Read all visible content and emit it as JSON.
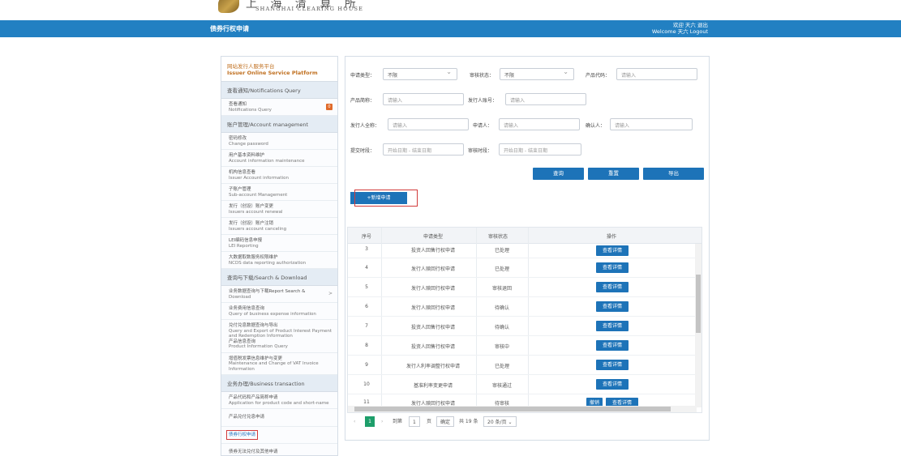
{
  "logo": {
    "cn": "上 海 清 算 所",
    "en": "SHANGHAI CLEARING HOUSE"
  },
  "banner": {
    "title": "债券行权申请",
    "user_cn": "欢迎 天六 退出",
    "user_en": "Welcome 天六 Logout"
  },
  "sidebar": {
    "header_cn": "网站发行人服务平台",
    "header_en": "Issuer Online Service Platform",
    "groups": [
      {
        "title": "查看通知/Notifications Query",
        "items": [
          {
            "cn": "查看通知",
            "en": "Notifications Query",
            "badge": "0"
          }
        ]
      },
      {
        "title": "账户管理/Account management",
        "items": [
          {
            "cn": "密码修改",
            "en": "Change password"
          },
          {
            "cn": "用户基本资料维护",
            "en": "Account information maintenance"
          },
          {
            "cn": "机构信息查看",
            "en": "Issuer Account information"
          },
          {
            "cn": "子账户管理",
            "en": "Sub-account Management"
          },
          {
            "cn": "发行（创设）账户变更",
            "en": "Issuers account renewal"
          },
          {
            "cn": "发行（创设）账户注销",
            "en": "Issuers account canceling"
          },
          {
            "cn": "LEI编码信息申报",
            "en": "LEI Reporting"
          },
          {
            "cn": "大数据取数服务权限维护",
            "en": "NCDS data reporting authorization"
          }
        ]
      },
      {
        "title": "查询与下载/Search & Download",
        "items": [
          {
            "cn": "业务数据查询与下载Report Search &",
            "en": "Download",
            "arrow": ">"
          },
          {
            "cn": "业务费用信息查询",
            "en": "Query of business expense information"
          },
          {
            "cn": "兑付兑息数据查询与导出",
            "en": "Query and Export of Product Interest Payment and Redemption Information"
          },
          {
            "cn": "产品信息查询",
            "en": "Product Information Query"
          },
          {
            "cn": "增值税发票信息维护与变更",
            "en": "Maintenance and Change of VAT Invoice Information"
          }
        ]
      },
      {
        "title": "业务办理/Business transaction",
        "items": [
          {
            "cn": "产品代码和产品简称申请",
            "en": "Application for product code and short-name"
          },
          {
            "cn": "产品兑付兑息申请",
            "en": ""
          },
          {
            "cn": "债券行权申请",
            "en": "",
            "active": true
          },
          {
            "cn": "债券无法兑付及其他申请",
            "en": ""
          }
        ]
      }
    ]
  },
  "filters": {
    "apply_type_label": "申请类型：",
    "apply_type_value": "不限",
    "review_status_label": "审核状态：",
    "review_status_value": "不限",
    "product_code_label": "产品代码：",
    "product_name_label": "产品简称：",
    "issuer_account_label": "发行人账号：",
    "issuer_name_label": "发行人全称：",
    "applicant_label": "申请人：",
    "confirmer_label": "确认人：",
    "submit_time_label": "提交时段：",
    "review_time_label": "审核时段：",
    "placeholder": "请输入",
    "date_placeholder": "开始日期 - 结束日期"
  },
  "buttons": {
    "query": "查询",
    "reset": "重置",
    "export": "导出",
    "new_apply": "+新增申请"
  },
  "table": {
    "headers": [
      "序号",
      "申请类型",
      "审核状态",
      "操作"
    ],
    "rows": [
      {
        "no": "3",
        "type": "投资人回售行权申请",
        "status": "已处理",
        "actions": [
          "查看详情"
        ]
      },
      {
        "no": "4",
        "type": "发行人赎回行权申请",
        "status": "已处理",
        "actions": [
          "查看详情"
        ]
      },
      {
        "no": "5",
        "type": "发行人赎回行权申请",
        "status": "审核退回",
        "actions": [
          "查看详情"
        ]
      },
      {
        "no": "6",
        "type": "发行人赎回行权申请",
        "status": "待确认",
        "actions": [
          "查看详情"
        ]
      },
      {
        "no": "7",
        "type": "投资人回售行权申请",
        "status": "待确认",
        "actions": [
          "查看详情"
        ]
      },
      {
        "no": "8",
        "type": "投资人回售行权申请",
        "status": "审核中",
        "actions": [
          "查看详情"
        ]
      },
      {
        "no": "9",
        "type": "发行人利率调整行权申请",
        "status": "已处理",
        "actions": [
          "查看详情"
        ]
      },
      {
        "no": "10",
        "type": "基准利率变更申请",
        "status": "审核通过",
        "actions": [
          "查看详情"
        ]
      },
      {
        "no": "11",
        "type": "发行人赎回行权申请",
        "status": "待审核",
        "actions": [
          "撤销",
          "查看详情"
        ]
      }
    ]
  },
  "pager": {
    "current": "1",
    "goto_label": "到第",
    "goto_value": "1",
    "page_unit": "页",
    "confirm": "确定",
    "total": "共 19 条",
    "page_size": "20 条/页"
  },
  "colors": {
    "banner": "#2280c2",
    "button": "#1d73b8",
    "highlight": "#d23b3b",
    "pager_active": "#1d9e6a"
  }
}
